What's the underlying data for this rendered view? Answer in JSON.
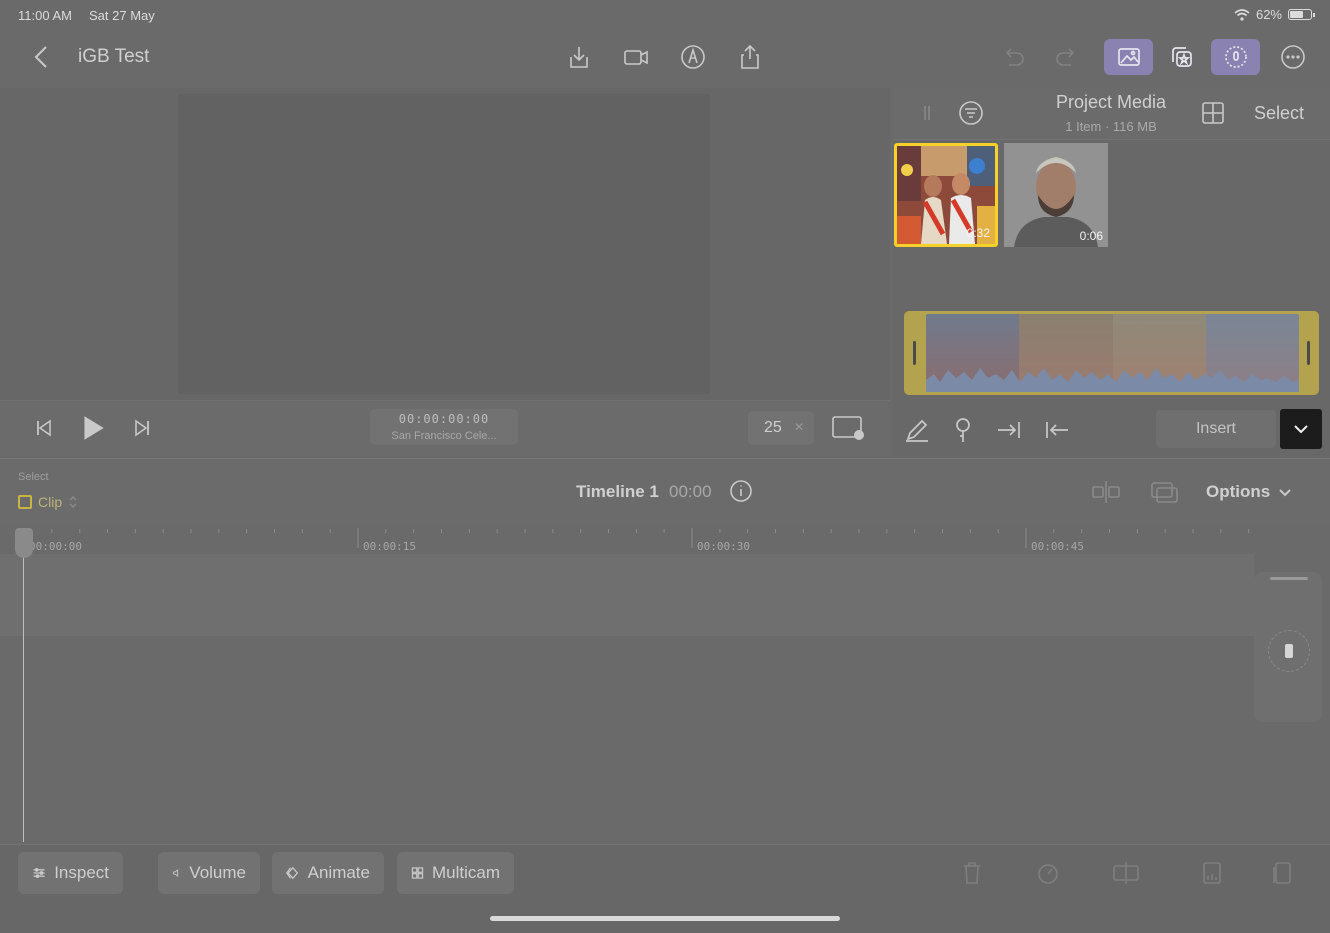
{
  "status": {
    "time": "11:00 AM",
    "date": "Sat 27 May",
    "battery": "62%"
  },
  "nav": {
    "title": "iGB Test"
  },
  "viewer": {
    "timecode": "00:00:00:00",
    "clip_name": "San Francisco Cele...",
    "fps": "25"
  },
  "browser": {
    "title": "Project Media",
    "subtitle": "1 Item  ·  116 MB",
    "select_label": "Select",
    "thumbs": [
      {
        "duration": "0:32"
      },
      {
        "duration": "0:06"
      }
    ],
    "insert_label": "Insert"
  },
  "timeline": {
    "select_label": "Select",
    "clip_label": "Clip",
    "title": "Timeline 1",
    "time": "00:00",
    "options_label": "Options",
    "ticks": [
      "00:00:00",
      "00:00:15",
      "00:00:30",
      "00:00:45"
    ]
  },
  "bottom": {
    "inspect": "Inspect",
    "volume": "Volume",
    "animate": "Animate",
    "multicam": "Multicam"
  },
  "colors": {
    "accent": "#8a83b2",
    "selection": "#f5d12a",
    "clip": "#b3a34e"
  }
}
